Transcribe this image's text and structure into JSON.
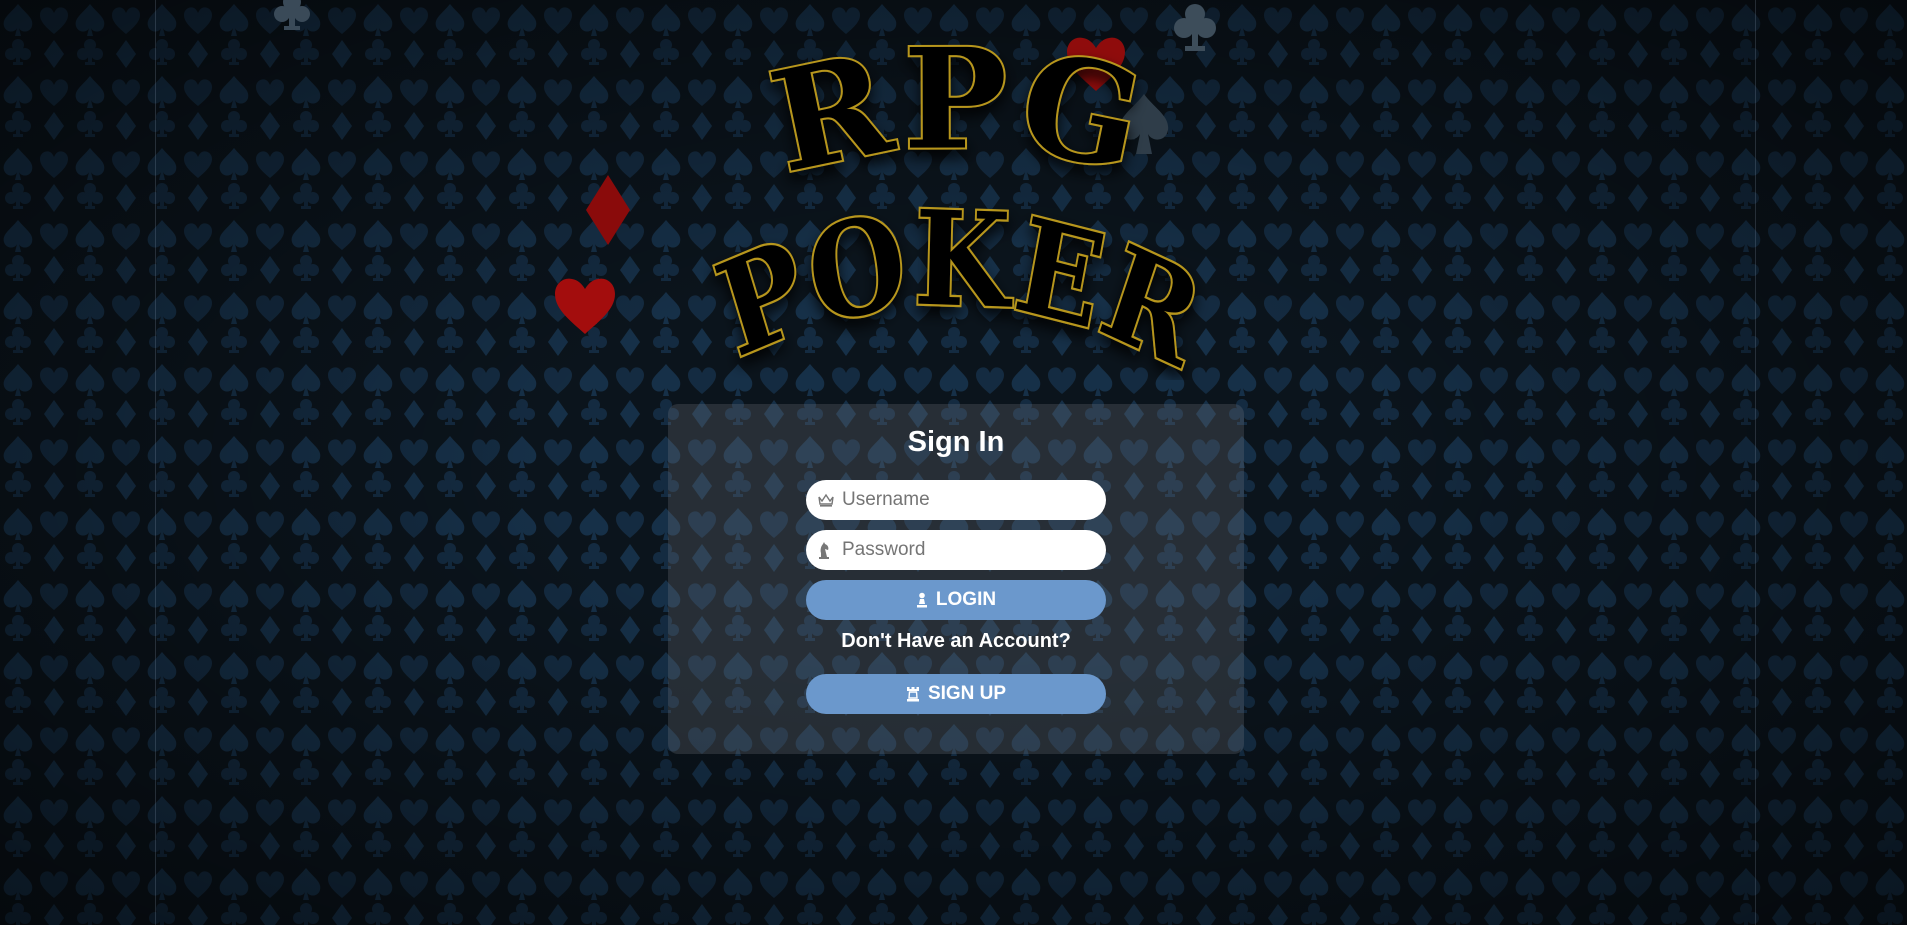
{
  "logo": {
    "line1": "RPG",
    "line2": "POKER"
  },
  "signin": {
    "title": "Sign In",
    "username_placeholder": "Username",
    "password_placeholder": "Password",
    "login_label": "LOGIN",
    "no_account_text": "Don't Have an Account?",
    "signup_label": "SIGN UP"
  },
  "icons": {
    "username": "crown-icon",
    "password": "chess-knight-icon",
    "login": "chess-pawn-icon",
    "signup": "chess-rook-icon"
  },
  "colors": {
    "background": "#0b141c",
    "pattern_suit": "#173149",
    "logo_fill": "#050505",
    "logo_outline": "#b7961f",
    "deco_red": "#8a0b0b",
    "button": "#6b98cc",
    "panel": "rgba(120,125,132,0.26)"
  }
}
